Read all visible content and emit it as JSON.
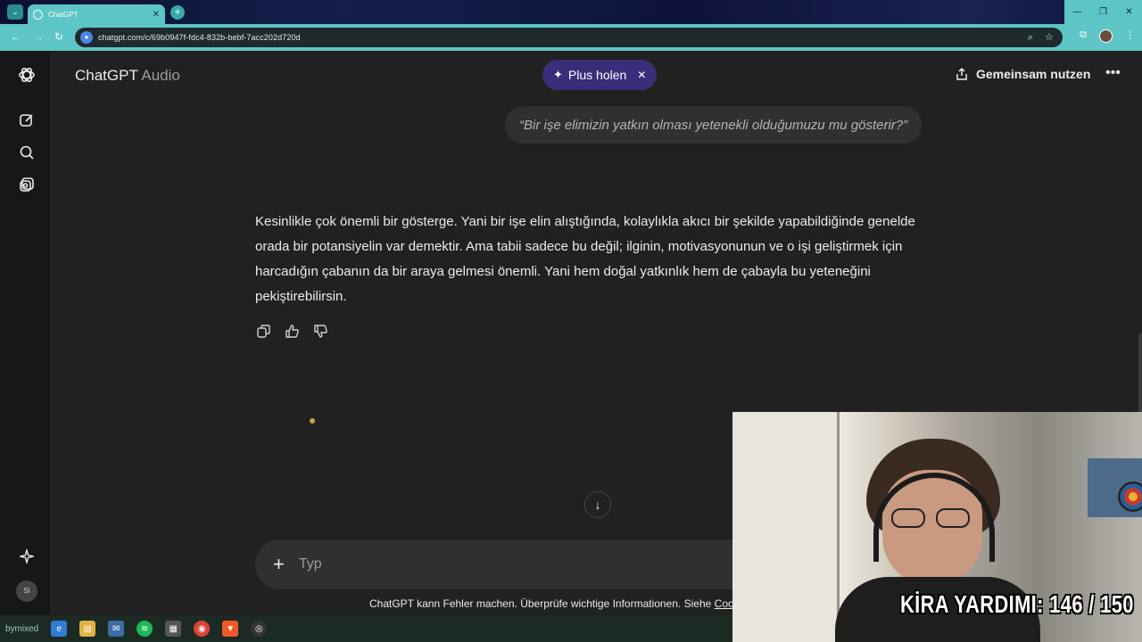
{
  "browser": {
    "tab_title": "ChatGPT",
    "url": "chatgpt.com/c/69b0947f-fdc4-832b-bebf-7acc202d720d"
  },
  "header": {
    "title": "ChatGPT",
    "title_suffix": "Audio",
    "upgrade_label": "Plus holen",
    "share_label": "Gemeinsam nutzen"
  },
  "conversation": {
    "user_message": "“Bir işe elimizin yatkın olması yetenekli olduğumuzu mu gösterir?”",
    "assistant_message": "Kesinlikle çok önemli bir gösterge. Yani bir işe elin alıştığında, kolaylıkla akıcı bir şekilde yapabildiğinde genelde orada bir potansiyelin var demektir. Ama tabii sadece bu değil; ilginin, motivasyonunun ve o işi geliştirmek için harcadığın çabanın da bir araya gelmesi önemli. Yani hem doğal yatkınlık hem de çabayla bu yeteneğini pekiştirebilirsin."
  },
  "composer": {
    "placeholder": "Typ"
  },
  "footer": {
    "disclaimer": "ChatGPT kann Fehler machen. Überprüfe wichtige Informationen. Siehe ",
    "cookie_link": "Cook"
  },
  "sidebar": {
    "avatar_initials": "SI"
  },
  "overlay": {
    "counter_text": "KİRA YARDIMI:  146 / 150"
  },
  "taskbar": {
    "weather_text": "bymixed"
  },
  "colors": {
    "background": "#212121",
    "rail": "#171717",
    "browser_accent": "#5ec5c6",
    "upgrade_pill": "#3b2d7a"
  }
}
